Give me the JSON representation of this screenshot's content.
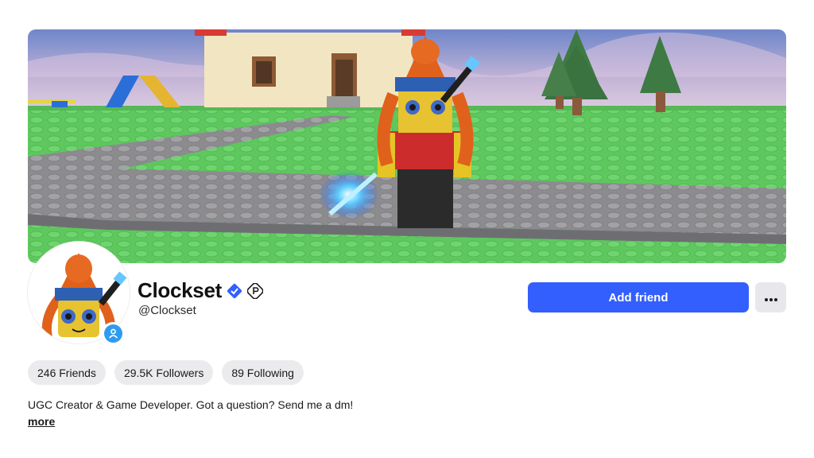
{
  "profile": {
    "display_name": "Clockset",
    "username": "@Clockset",
    "verified_icon": "verified-badge-icon",
    "premium_icon": "premium-icon",
    "presence_icon": "online-status-icon",
    "accent_color": "#335fff",
    "bio": "UGC Creator & Game Developer. Got a question? Send me a dm!",
    "more_label": "more"
  },
  "actions": {
    "add_friend_label": "Add friend",
    "more_options_icon": "ellipsis-icon"
  },
  "stats": [
    {
      "label": "246 Friends"
    },
    {
      "label": "29.5K Followers"
    },
    {
      "label": "89 Following"
    }
  ],
  "banner": {
    "description_icon": "profile-banner-image"
  }
}
